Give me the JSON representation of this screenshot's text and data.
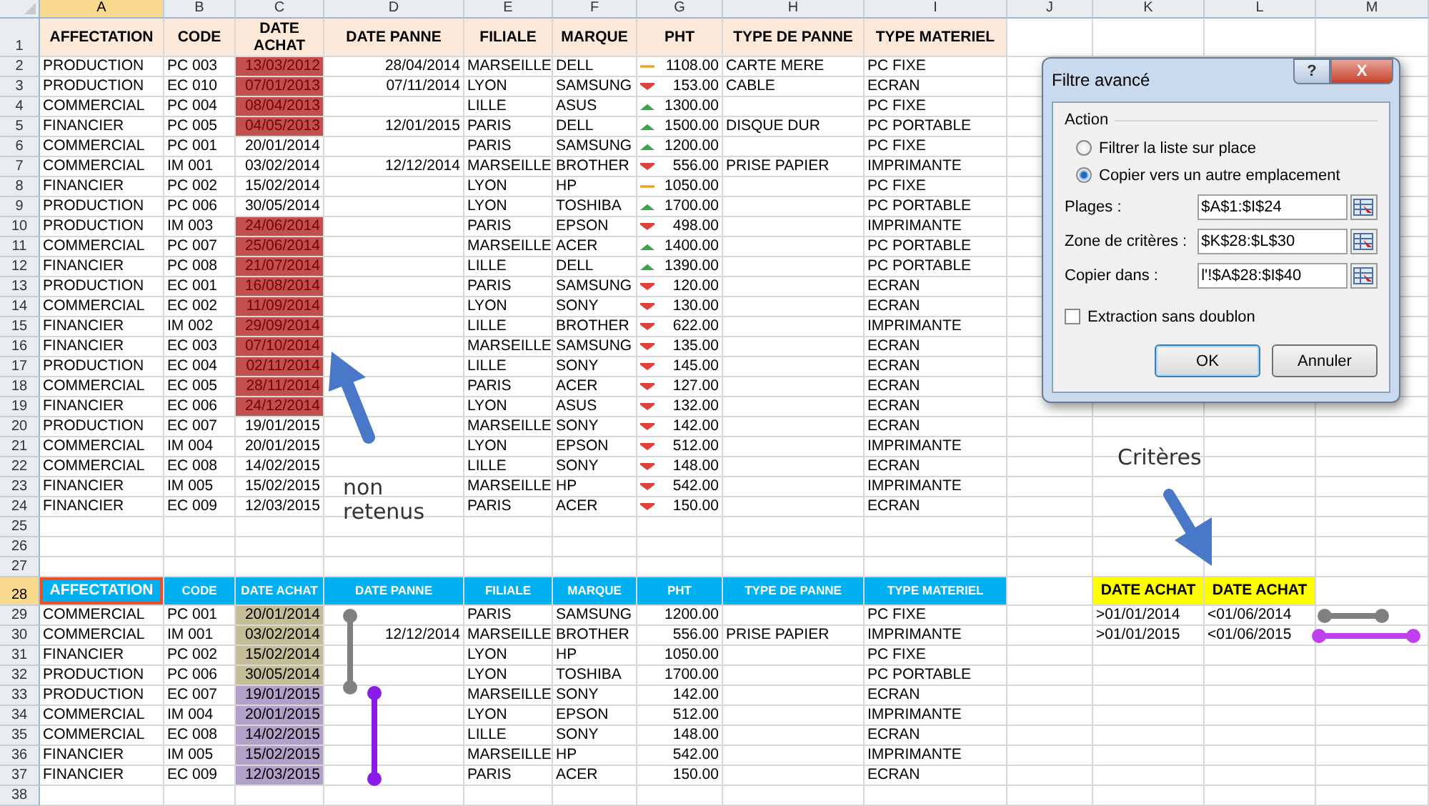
{
  "column_headers": [
    {
      "label": "A",
      "selected": true
    },
    {
      "label": "B",
      "selected": false
    },
    {
      "label": "C",
      "selected": false
    },
    {
      "label": "D",
      "selected": false
    },
    {
      "label": "E",
      "selected": false
    },
    {
      "label": "F",
      "selected": false
    },
    {
      "label": "G",
      "selected": false
    },
    {
      "label": "H",
      "selected": false
    },
    {
      "label": "I",
      "selected": false
    },
    {
      "label": "J",
      "selected": false
    },
    {
      "label": "K",
      "selected": false
    },
    {
      "label": "L",
      "selected": false
    },
    {
      "label": "M",
      "selected": false
    }
  ],
  "row_headers": [
    {
      "label": "1",
      "selected": false
    },
    {
      "label": "2",
      "selected": false
    },
    {
      "label": "3",
      "selected": false
    },
    {
      "label": "4",
      "selected": false
    },
    {
      "label": "5",
      "selected": false
    },
    {
      "label": "6",
      "selected": false
    },
    {
      "label": "7",
      "selected": false
    },
    {
      "label": "8",
      "selected": false
    },
    {
      "label": "9",
      "selected": false
    },
    {
      "label": "10",
      "selected": false
    },
    {
      "label": "11",
      "selected": false
    },
    {
      "label": "12",
      "selected": false
    },
    {
      "label": "13",
      "selected": false
    },
    {
      "label": "14",
      "selected": false
    },
    {
      "label": "15",
      "selected": false
    },
    {
      "label": "16",
      "selected": false
    },
    {
      "label": "17",
      "selected": false
    },
    {
      "label": "18",
      "selected": false
    },
    {
      "label": "19",
      "selected": false
    },
    {
      "label": "20",
      "selected": false
    },
    {
      "label": "21",
      "selected": false
    },
    {
      "label": "22",
      "selected": false
    },
    {
      "label": "23",
      "selected": false
    },
    {
      "label": "24",
      "selected": false
    },
    {
      "label": "25",
      "selected": false
    },
    {
      "label": "26",
      "selected": false
    },
    {
      "label": "27",
      "selected": false
    },
    {
      "label": "28",
      "selected": true
    },
    {
      "label": "29",
      "selected": false
    },
    {
      "label": "30",
      "selected": false
    },
    {
      "label": "31",
      "selected": false
    },
    {
      "label": "32",
      "selected": false
    },
    {
      "label": "33",
      "selected": false
    },
    {
      "label": "34",
      "selected": false
    },
    {
      "label": "35",
      "selected": false
    },
    {
      "label": "36",
      "selected": false
    },
    {
      "label": "37",
      "selected": false
    },
    {
      "label": "38",
      "selected": false
    }
  ],
  "main_table": {
    "columns": [
      "AFFECTATION",
      "CODE",
      "DATE ACHAT",
      "DATE PANNE",
      "FILIALE",
      "MARQUE",
      "PHT",
      "TYPE DE PANNE",
      "TYPE MATERIEL"
    ],
    "rows": [
      {
        "affectation": "PRODUCTION",
        "code": "PC 003",
        "date_achat": "13/03/2012",
        "flagged": true,
        "date_panne": "28/04/2014",
        "filiale": "MARSEILLE",
        "marque": "DELL",
        "pht": "1108.00",
        "kind": "flat",
        "type_de_panne": "CARTE MERE",
        "type_materiel": "PC FIXE"
      },
      {
        "affectation": "PRODUCTION",
        "code": "EC 010",
        "date_achat": "07/01/2013",
        "flagged": true,
        "date_panne": "07/11/2014",
        "filiale": "LYON",
        "marque": "SAMSUNG",
        "pht": "153.00",
        "kind": "down",
        "type_de_panne": "CABLE",
        "type_materiel": "ECRAN"
      },
      {
        "affectation": "COMMERCIAL",
        "code": "PC 004",
        "date_achat": "08/04/2013",
        "flagged": true,
        "filiale": "LILLE",
        "marque": "ASUS",
        "pht": "1300.00",
        "kind": "up",
        "type_materiel": "PC FIXE"
      },
      {
        "affectation": "FINANCIER",
        "code": "PC 005",
        "date_achat": "04/05/2013",
        "flagged": true,
        "date_panne": "12/01/2015",
        "filiale": "PARIS",
        "marque": "DELL",
        "pht": "1500.00",
        "kind": "up",
        "type_de_panne": "DISQUE DUR",
        "type_materiel": "PC PORTABLE"
      },
      {
        "affectation": "COMMERCIAL",
        "code": "PC 001",
        "date_achat": "20/01/2014",
        "flagged": false,
        "filiale": "PARIS",
        "marque": "SAMSUNG",
        "pht": "1200.00",
        "kind": "up",
        "type_materiel": "PC FIXE"
      },
      {
        "affectation": "COMMERCIAL",
        "code": "IM 001",
        "date_achat": "03/02/2014",
        "flagged": false,
        "date_panne": "12/12/2014",
        "filiale": "MARSEILLE",
        "marque": "BROTHER",
        "pht": "556.00",
        "kind": "down",
        "type_de_panne": "PRISE PAPIER",
        "type_materiel": "IMPRIMANTE"
      },
      {
        "affectation": "FINANCIER",
        "code": "PC 002",
        "date_achat": "15/02/2014",
        "flagged": false,
        "filiale": "LYON",
        "marque": "HP",
        "pht": "1050.00",
        "kind": "flat",
        "type_materiel": "PC FIXE"
      },
      {
        "affectation": "PRODUCTION",
        "code": "PC 006",
        "date_achat": "30/05/2014",
        "flagged": false,
        "filiale": "LYON",
        "marque": "TOSHIBA",
        "pht": "1700.00",
        "kind": "up",
        "type_materiel": "PC PORTABLE"
      },
      {
        "affectation": "PRODUCTION",
        "code": "IM 003",
        "date_achat": "24/06/2014",
        "flagged": true,
        "filiale": "PARIS",
        "marque": "EPSON",
        "pht": "498.00",
        "kind": "down",
        "type_materiel": "IMPRIMANTE"
      },
      {
        "affectation": "COMMERCIAL",
        "code": "PC 007",
        "date_achat": "25/06/2014",
        "flagged": true,
        "filiale": "MARSEILLE",
        "marque": "ACER",
        "pht": "1400.00",
        "kind": "up",
        "type_materiel": "PC PORTABLE"
      },
      {
        "affectation": "FINANCIER",
        "code": "PC 008",
        "date_achat": "21/07/2014",
        "flagged": true,
        "filiale": "LILLE",
        "marque": "DELL",
        "pht": "1390.00",
        "kind": "up",
        "type_materiel": "PC PORTABLE"
      },
      {
        "affectation": "PRODUCTION",
        "code": "EC 001",
        "date_achat": "16/08/2014",
        "flagged": true,
        "filiale": "PARIS",
        "marque": "SAMSUNG",
        "pht": "120.00",
        "kind": "down",
        "type_materiel": "ECRAN"
      },
      {
        "affectation": "COMMERCIAL",
        "code": "EC 002",
        "date_achat": "11/09/2014",
        "flagged": true,
        "filiale": "LYON",
        "marque": "SONY",
        "pht": "130.00",
        "kind": "down",
        "type_materiel": "ECRAN"
      },
      {
        "affectation": "FINANCIER",
        "code": "IM 002",
        "date_achat": "29/09/2014",
        "flagged": true,
        "filiale": "LILLE",
        "marque": "BROTHER",
        "pht": "622.00",
        "kind": "down",
        "type_materiel": "IMPRIMANTE"
      },
      {
        "affectation": "FINANCIER",
        "code": "EC 003",
        "date_achat": "07/10/2014",
        "flagged": true,
        "filiale": "MARSEILLE",
        "marque": "SAMSUNG",
        "pht": "135.00",
        "kind": "down",
        "type_materiel": "ECRAN"
      },
      {
        "affectation": "PRODUCTION",
        "code": "EC 004",
        "date_achat": "02/11/2014",
        "flagged": true,
        "filiale": "LILLE",
        "marque": "SONY",
        "pht": "145.00",
        "kind": "down",
        "type_materiel": "ECRAN"
      },
      {
        "affectation": "COMMERCIAL",
        "code": "EC 005",
        "date_achat": "28/11/2014",
        "flagged": true,
        "filiale": "PARIS",
        "marque": "ACER",
        "pht": "127.00",
        "kind": "down",
        "type_materiel": "ECRAN"
      },
      {
        "affectation": "FINANCIER",
        "code": "EC 006",
        "date_achat": "24/12/2014",
        "flagged": true,
        "filiale": "LYON",
        "marque": "ASUS",
        "pht": "132.00",
        "kind": "down",
        "type_materiel": "ECRAN"
      },
      {
        "affectation": "PRODUCTION",
        "code": "EC 007",
        "date_achat": "19/01/2015",
        "flagged": false,
        "filiale": "MARSEILLE",
        "marque": "SONY",
        "pht": "142.00",
        "kind": "down",
        "type_materiel": "ECRAN"
      },
      {
        "affectation": "COMMERCIAL",
        "code": "IM 004",
        "date_achat": "20/01/2015",
        "flagged": false,
        "filiale": "LYON",
        "marque": "EPSON",
        "pht": "512.00",
        "kind": "down",
        "type_materiel": "IMPRIMANTE"
      },
      {
        "affectation": "COMMERCIAL",
        "code": "EC 008",
        "date_achat": "14/02/2015",
        "flagged": false,
        "filiale": "LILLE",
        "marque": "SONY",
        "pht": "148.00",
        "kind": "down",
        "type_materiel": "ECRAN"
      },
      {
        "affectation": "FINANCIER",
        "code": "IM 005",
        "date_achat": "15/02/2015",
        "flagged": false,
        "filiale": "MARSEILLE",
        "marque": "HP",
        "pht": "542.00",
        "kind": "down",
        "type_materiel": "IMPRIMANTE"
      },
      {
        "affectation": "FINANCIER",
        "code": "EC 009",
        "date_achat": "12/03/2015",
        "flagged": false,
        "filiale": "PARIS",
        "marque": "ACER",
        "pht": "150.00",
        "kind": "down",
        "type_materiel": "ECRAN"
      }
    ]
  },
  "extract_table": {
    "columns": [
      {
        "label": "AFFECTATION",
        "selected": true
      },
      {
        "label": "CODE",
        "selected": false
      },
      {
        "label": "DATE ACHAT",
        "selected": false
      },
      {
        "label": "DATE PANNE",
        "selected": false
      },
      {
        "label": "FILIALE",
        "selected": false
      },
      {
        "label": "MARQUE",
        "selected": false
      },
      {
        "label": "PHT",
        "selected": false
      },
      {
        "label": "TYPE DE PANNE",
        "selected": false
      },
      {
        "label": "TYPE MATERIEL",
        "selected": false
      }
    ],
    "rows": [
      {
        "affectation": "COMMERCIAL",
        "code": "PC 001",
        "date_achat": "20/01/2014",
        "color": "#c4bd97",
        "filiale": "PARIS",
        "marque": "SAMSUNG",
        "pht": "1200.00",
        "type_materiel": "PC FIXE"
      },
      {
        "affectation": "COMMERCIAL",
        "code": "IM 001",
        "date_achat": "03/02/2014",
        "color": "#c4bd97",
        "date_panne": "12/12/2014",
        "filiale": "MARSEILLE",
        "marque": "BROTHER",
        "pht": "556.00",
        "type_de_panne": "PRISE PAPIER",
        "type_materiel": "IMPRIMANTE"
      },
      {
        "affectation": "FINANCIER",
        "code": "PC 002",
        "date_achat": "15/02/2014",
        "color": "#c4bd97",
        "filiale": "LYON",
        "marque": "HP",
        "pht": "1050.00",
        "type_materiel": "PC FIXE"
      },
      {
        "affectation": "PRODUCTION",
        "code": "PC 006",
        "date_achat": "30/05/2014",
        "color": "#c4bd97",
        "filiale": "LYON",
        "marque": "TOSHIBA",
        "pht": "1700.00",
        "type_materiel": "PC PORTABLE"
      },
      {
        "affectation": "PRODUCTION",
        "code": "EC 007",
        "date_achat": "19/01/2015",
        "color": "#b1a0c7",
        "filiale": "MARSEILLE",
        "marque": "SONY",
        "pht": "142.00",
        "type_materiel": "ECRAN"
      },
      {
        "affectation": "COMMERCIAL",
        "code": "IM 004",
        "date_achat": "20/01/2015",
        "color": "#b1a0c7",
        "filiale": "LYON",
        "marque": "EPSON",
        "pht": "512.00",
        "type_materiel": "IMPRIMANTE"
      },
      {
        "affectation": "COMMERCIAL",
        "code": "EC 008",
        "date_achat": "14/02/2015",
        "color": "#b1a0c7",
        "filiale": "LILLE",
        "marque": "SONY",
        "pht": "148.00",
        "type_materiel": "ECRAN"
      },
      {
        "affectation": "FINANCIER",
        "code": "IM 005",
        "date_achat": "15/02/2015",
        "color": "#b1a0c7",
        "filiale": "MARSEILLE",
        "marque": "HP",
        "pht": "542.00",
        "type_materiel": "IMPRIMANTE"
      },
      {
        "affectation": "FINANCIER",
        "code": "EC 009",
        "date_achat": "12/03/2015",
        "color": "#b1a0c7",
        "filiale": "PARIS",
        "marque": "ACER",
        "pht": "150.00",
        "type_materiel": "ECRAN"
      }
    ]
  },
  "criteria": {
    "columns": [
      "DATE ACHAT",
      "DATE ACHAT"
    ],
    "rows": [
      [
        ">01/01/2014",
        "<01/06/2014"
      ],
      [
        ">01/01/2015",
        "<01/06/2015"
      ]
    ]
  },
  "annotations": {
    "excluded_label": "non retenus",
    "criteria_label": "Critères"
  },
  "dialog": {
    "title": "Filtre avancé",
    "help": "?",
    "close": "X",
    "group_label": "Action",
    "options": [
      {
        "label": "Filtrer la liste sur place",
        "selected": false
      },
      {
        "label": "Copier vers un autre emplacement",
        "selected": true
      }
    ],
    "fields": [
      {
        "label": "Plages :",
        "value": "$A$1:$I$24"
      },
      {
        "label": "Zone de critères :",
        "value": "$K$28:$L$30"
      },
      {
        "label": "Copier dans :",
        "value": "l'!$A$28:$I$40"
      }
    ],
    "unique": {
      "label": "Extraction sans doublon",
      "checked": false
    },
    "buttons": [
      "OK",
      "Annuler"
    ]
  }
}
